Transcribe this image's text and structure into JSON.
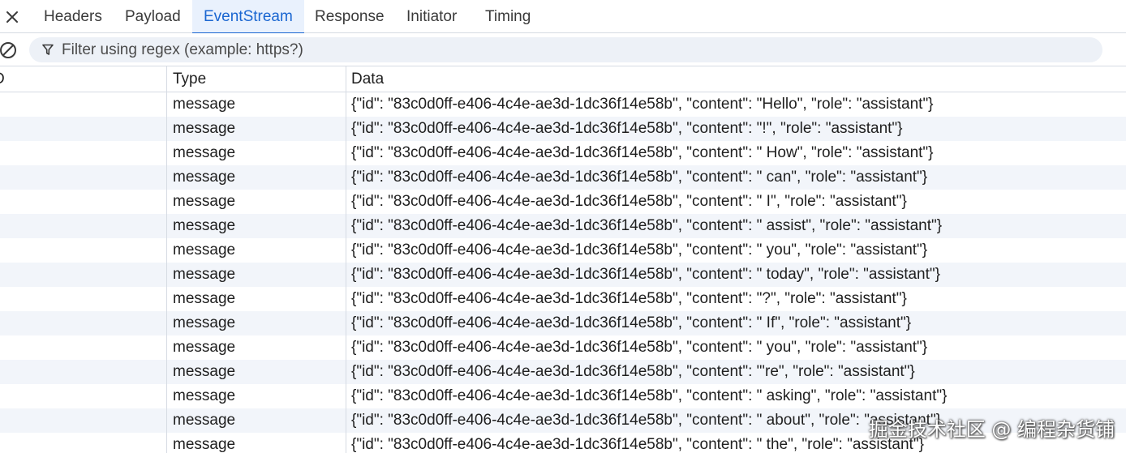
{
  "tabs": [
    {
      "label": "Headers",
      "active": false
    },
    {
      "label": "Payload",
      "active": false
    },
    {
      "label": "EventStream",
      "active": true
    },
    {
      "label": "Response",
      "active": false
    },
    {
      "label": "Initiator",
      "active": false
    },
    {
      "label": "Timing",
      "active": false
    }
  ],
  "icons": {
    "close": "close-icon",
    "clear": "clear-icon",
    "filter": "filter-icon"
  },
  "filter": {
    "placeholder": "Filter using regex (example: https?)",
    "value": ""
  },
  "columns": {
    "id": "D",
    "type": "Type",
    "data": "Data"
  },
  "rows": [
    {
      "id": "",
      "type": "message",
      "data": "{\"id\": \"83c0d0ff-e406-4c4e-ae3d-1dc36f14e58b\", \"content\": \"Hello\", \"role\": \"assistant\"}"
    },
    {
      "id": "",
      "type": "message",
      "data": "{\"id\": \"83c0d0ff-e406-4c4e-ae3d-1dc36f14e58b\", \"content\": \"!\", \"role\": \"assistant\"}"
    },
    {
      "id": "",
      "type": "message",
      "data": "{\"id\": \"83c0d0ff-e406-4c4e-ae3d-1dc36f14e58b\", \"content\": \" How\", \"role\": \"assistant\"}"
    },
    {
      "id": "",
      "type": "message",
      "data": "{\"id\": \"83c0d0ff-e406-4c4e-ae3d-1dc36f14e58b\", \"content\": \" can\", \"role\": \"assistant\"}"
    },
    {
      "id": "",
      "type": "message",
      "data": "{\"id\": \"83c0d0ff-e406-4c4e-ae3d-1dc36f14e58b\", \"content\": \" I\", \"role\": \"assistant\"}"
    },
    {
      "id": "",
      "type": "message",
      "data": "{\"id\": \"83c0d0ff-e406-4c4e-ae3d-1dc36f14e58b\", \"content\": \" assist\", \"role\": \"assistant\"}"
    },
    {
      "id": "",
      "type": "message",
      "data": "{\"id\": \"83c0d0ff-e406-4c4e-ae3d-1dc36f14e58b\", \"content\": \" you\", \"role\": \"assistant\"}"
    },
    {
      "id": "",
      "type": "message",
      "data": "{\"id\": \"83c0d0ff-e406-4c4e-ae3d-1dc36f14e58b\", \"content\": \" today\", \"role\": \"assistant\"}"
    },
    {
      "id": "",
      "type": "message",
      "data": "{\"id\": \"83c0d0ff-e406-4c4e-ae3d-1dc36f14e58b\", \"content\": \"?\", \"role\": \"assistant\"}"
    },
    {
      "id": "",
      "type": "message",
      "data": "{\"id\": \"83c0d0ff-e406-4c4e-ae3d-1dc36f14e58b\", \"content\": \" If\", \"role\": \"assistant\"}"
    },
    {
      "id": "",
      "type": "message",
      "data": "{\"id\": \"83c0d0ff-e406-4c4e-ae3d-1dc36f14e58b\", \"content\": \" you\", \"role\": \"assistant\"}"
    },
    {
      "id": "",
      "type": "message",
      "data": "{\"id\": \"83c0d0ff-e406-4c4e-ae3d-1dc36f14e58b\", \"content\": \"'re\", \"role\": \"assistant\"}"
    },
    {
      "id": "",
      "type": "message",
      "data": "{\"id\": \"83c0d0ff-e406-4c4e-ae3d-1dc36f14e58b\", \"content\": \" asking\", \"role\": \"assistant\"}"
    },
    {
      "id": "",
      "type": "message",
      "data": "{\"id\": \"83c0d0ff-e406-4c4e-ae3d-1dc36f14e58b\", \"content\": \" about\", \"role\": \"assistant\"}"
    },
    {
      "id": "",
      "type": "message",
      "data": "{\"id\": \"83c0d0ff-e406-4c4e-ae3d-1dc36f14e58b\", \"content\": \" the\", \"role\": \"assistant\"}"
    }
  ],
  "watermark": "掘金技术社区 @ 编程杂货铺",
  "colors": {
    "accent": "#1a66d1",
    "active_tab_bg": "#e9f1fd",
    "filter_bg": "#edf1f7",
    "alt_row_bg": "#f2f5fa",
    "border": "#d6dbe3"
  }
}
